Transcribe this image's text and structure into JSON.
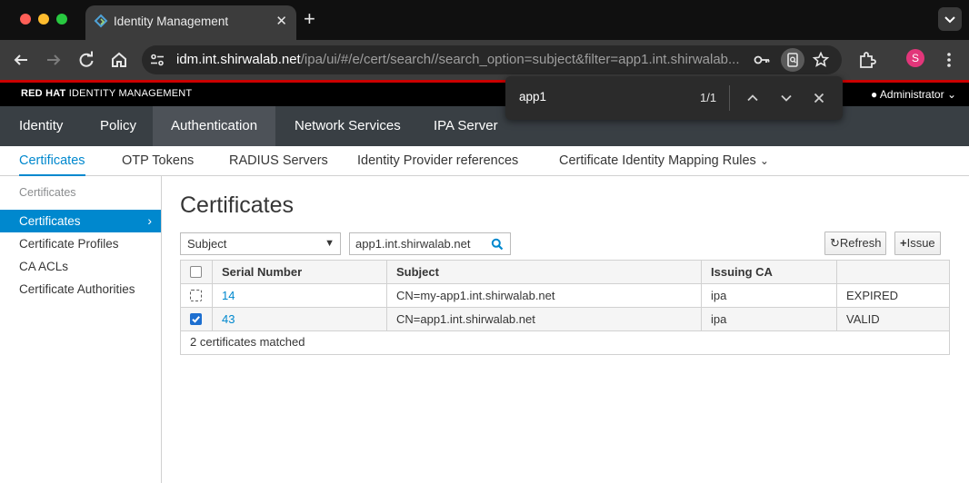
{
  "browser": {
    "tab_title": "Identity Management",
    "url_host": "idm.int.shirwalab.net",
    "url_path": "/ipa/ui/#/e/cert/search//search_option=subject&filter=app1.int.shirwalab...",
    "profile_initial": "S"
  },
  "find_bar": {
    "query": "app1",
    "count": "1/1"
  },
  "header": {
    "brand_bold": "RED HAT",
    "brand_rest": "IDENTITY MANAGEMENT",
    "user_menu": "Administrator"
  },
  "top_nav": [
    {
      "label": "Identity"
    },
    {
      "label": "Policy"
    },
    {
      "label": "Authentication"
    },
    {
      "label": "Network Services"
    },
    {
      "label": "IPA Server"
    }
  ],
  "sub_nav": [
    {
      "label": "Certificates"
    },
    {
      "label": "OTP Tokens"
    },
    {
      "label": "RADIUS Servers"
    },
    {
      "label": "Identity Provider references"
    },
    {
      "label": "Certificate Identity Mapping Rules"
    }
  ],
  "sidebar": {
    "heading": "Certificates",
    "items": [
      {
        "label": "Certificates"
      },
      {
        "label": "Certificate Profiles"
      },
      {
        "label": "CA ACLs"
      },
      {
        "label": "Certificate Authorities"
      }
    ]
  },
  "main": {
    "title": "Certificates",
    "search_option": "Subject",
    "search_value": "app1.int.shirwalab.net",
    "refresh_label": "Refresh",
    "issue_label": "Issue"
  },
  "table": {
    "headers": [
      "Serial Number",
      "Subject",
      "Issuing CA",
      ""
    ],
    "rows": [
      {
        "serial": "14",
        "subject": "CN=my-app1.int.shirwalab.net",
        "ca": "ipa",
        "status": "EXPIRED",
        "checked": false
      },
      {
        "serial": "43",
        "subject": "CN=app1.int.shirwalab.net",
        "ca": "ipa",
        "status": "VALID",
        "checked": true
      }
    ],
    "footer": "2 certificates matched"
  },
  "colors": {
    "accent": "#0088ce",
    "brand_red": "#cc0000",
    "nav_bg": "#393f44",
    "nav_active": "#4d5258"
  }
}
